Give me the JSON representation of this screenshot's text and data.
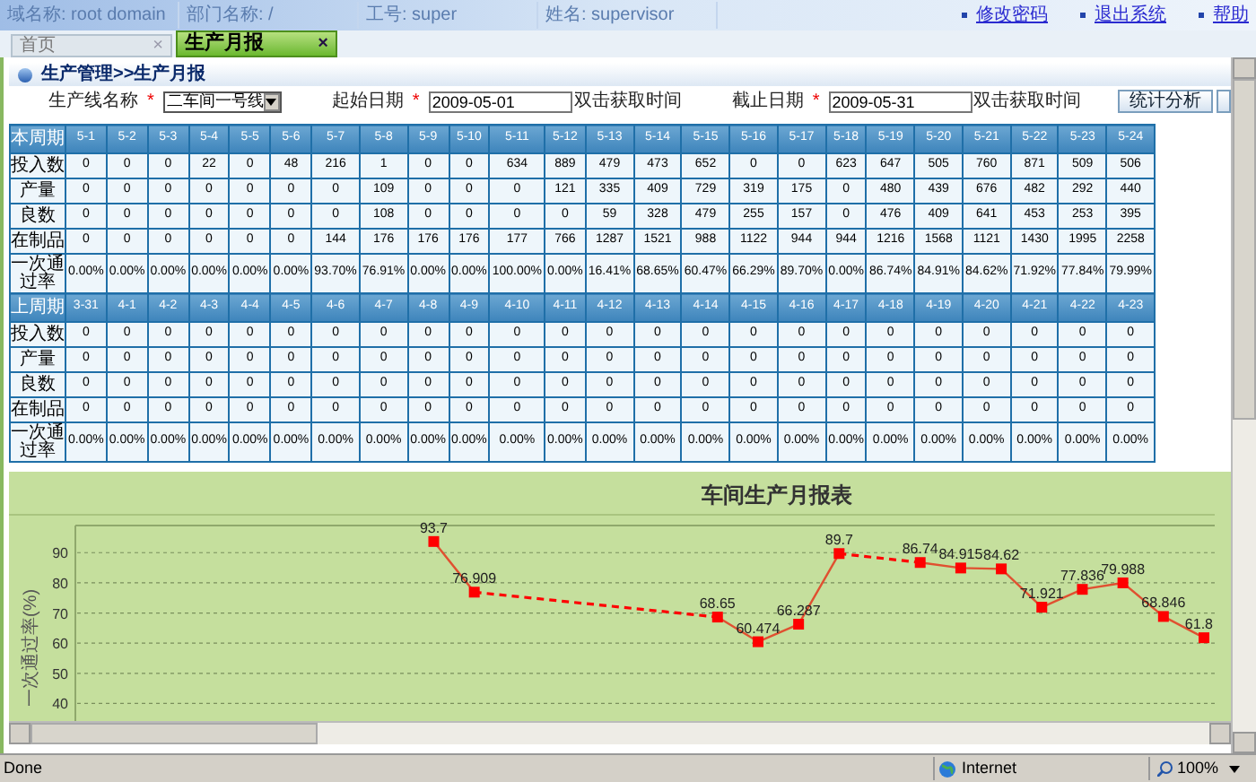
{
  "top_bar": {
    "fields": [
      "域名称: root domain",
      "部门名称: /",
      "工号: super",
      "姓名: supervisor"
    ],
    "links": [
      "修改密码",
      "退出系统",
      "帮助"
    ]
  },
  "tabs": [
    {
      "label": "首页",
      "close": "×",
      "selected": false
    },
    {
      "label": "生产月报",
      "close": "×",
      "selected": true
    }
  ],
  "breadcrumb": "生产管理>>生产月报",
  "form": {
    "fields": [
      {
        "kind": "select",
        "label": "生产线名称",
        "mark": "*",
        "value": "二车间一号线"
      },
      {
        "kind": "date",
        "label": "起始日期",
        "mark": "*",
        "value": "2009-05-01",
        "hint": "双击获取时间"
      },
      {
        "kind": "date",
        "label": "截止日期",
        "mark": "*",
        "value": "2009-05-31",
        "hint": "双击获取时间"
      }
    ],
    "button": "统计分析"
  },
  "tables": [
    {
      "period": "本周期",
      "dates": [
        "5-1",
        "5-2",
        "5-3",
        "5-4",
        "5-5",
        "5-6",
        "5-7",
        "5-8",
        "5-9",
        "5-10",
        "5-11",
        "5-12",
        "5-13",
        "5-14",
        "5-15",
        "5-16",
        "5-17",
        "5-18",
        "5-19",
        "5-20",
        "5-21",
        "5-22",
        "5-23",
        "5-24"
      ],
      "rows": [
        {
          "label": "投入数",
          "values": [
            "0",
            "0",
            "0",
            "22",
            "0",
            "48",
            "216",
            "1",
            "0",
            "0",
            "634",
            "889",
            "479",
            "473",
            "652",
            "0",
            "0",
            "623",
            "647",
            "505",
            "760",
            "871",
            "509",
            "506"
          ]
        },
        {
          "label": "产量",
          "values": [
            "0",
            "0",
            "0",
            "0",
            "0",
            "0",
            "0",
            "109",
            "0",
            "0",
            "0",
            "121",
            "335",
            "409",
            "729",
            "319",
            "175",
            "0",
            "480",
            "439",
            "676",
            "482",
            "292",
            "440"
          ]
        },
        {
          "label": "良数",
          "values": [
            "0",
            "0",
            "0",
            "0",
            "0",
            "0",
            "0",
            "108",
            "0",
            "0",
            "0",
            "0",
            "59",
            "328",
            "479",
            "255",
            "157",
            "0",
            "476",
            "409",
            "641",
            "453",
            "253",
            "395"
          ]
        },
        {
          "label": "在制品",
          "values": [
            "0",
            "0",
            "0",
            "0",
            "0",
            "0",
            "144",
            "176",
            "176",
            "176",
            "177",
            "766",
            "1287",
            "1521",
            "988",
            "1122",
            "944",
            "944",
            "1216",
            "1568",
            "1121",
            "1430",
            "1995",
            "2258"
          ]
        },
        {
          "label": "一次通过率",
          "values": [
            "0.00%",
            "0.00%",
            "0.00%",
            "0.00%",
            "0.00%",
            "0.00%",
            "93.70%",
            "76.91%",
            "0.00%",
            "0.00%",
            "100.00%",
            "0.00%",
            "16.41%",
            "68.65%",
            "60.47%",
            "66.29%",
            "89.70%",
            "0.00%",
            "86.74%",
            "84.91%",
            "84.62%",
            "71.92%",
            "77.84%",
            "79.99%"
          ]
        }
      ]
    },
    {
      "period": "上周期",
      "dates": [
        "3-31",
        "4-1",
        "4-2",
        "4-3",
        "4-4",
        "4-5",
        "4-6",
        "4-7",
        "4-8",
        "4-9",
        "4-10",
        "4-11",
        "4-12",
        "4-13",
        "4-14",
        "4-15",
        "4-16",
        "4-17",
        "4-18",
        "4-19",
        "4-20",
        "4-21",
        "4-22",
        "4-23"
      ],
      "rows": [
        {
          "label": "投入数",
          "values": [
            "0",
            "0",
            "0",
            "0",
            "0",
            "0",
            "0",
            "0",
            "0",
            "0",
            "0",
            "0",
            "0",
            "0",
            "0",
            "0",
            "0",
            "0",
            "0",
            "0",
            "0",
            "0",
            "0",
            "0"
          ]
        },
        {
          "label": "产量",
          "values": [
            "0",
            "0",
            "0",
            "0",
            "0",
            "0",
            "0",
            "0",
            "0",
            "0",
            "0",
            "0",
            "0",
            "0",
            "0",
            "0",
            "0",
            "0",
            "0",
            "0",
            "0",
            "0",
            "0",
            "0"
          ]
        },
        {
          "label": "良数",
          "values": [
            "0",
            "0",
            "0",
            "0",
            "0",
            "0",
            "0",
            "0",
            "0",
            "0",
            "0",
            "0",
            "0",
            "0",
            "0",
            "0",
            "0",
            "0",
            "0",
            "0",
            "0",
            "0",
            "0",
            "0"
          ]
        },
        {
          "label": "在制品",
          "values": [
            "0",
            "0",
            "0",
            "0",
            "0",
            "0",
            "0",
            "0",
            "0",
            "0",
            "0",
            "0",
            "0",
            "0",
            "0",
            "0",
            "0",
            "0",
            "0",
            "0",
            "0",
            "0",
            "0",
            "0"
          ]
        },
        {
          "label": "一次通过率",
          "values": [
            "0.00%",
            "0.00%",
            "0.00%",
            "0.00%",
            "0.00%",
            "0.00%",
            "0.00%",
            "0.00%",
            "0.00%",
            "0.00%",
            "0.00%",
            "0.00%",
            "0.00%",
            "0.00%",
            "0.00%",
            "0.00%",
            "0.00%",
            "0.00%",
            "0.00%",
            "0.00%",
            "0.00%",
            "0.00%",
            "0.00%",
            "0.00%"
          ]
        }
      ]
    }
  ],
  "chart": {
    "chart_data": {
      "type": "line",
      "title": "车间生产月报表",
      "ylabel": "一次通过率(%)",
      "series": [
        {
          "color": "#e05030",
          "marker": "square",
          "values": [
            null,
            null,
            null,
            null,
            null,
            null,
            null,
            null,
            93.7,
            76.909,
            null,
            null,
            null,
            null,
            null,
            68.65,
            60.474,
            66.287,
            89.7,
            null,
            86.74,
            84.915,
            84.62,
            71.921,
            77.836,
            79.988,
            68.846,
            61.8
          ]
        }
      ],
      "ylim": [
        33,
        99
      ],
      "yticks": [
        40,
        50,
        60,
        70,
        80,
        90
      ],
      "grid": true,
      "data_labels": true
    }
  },
  "status_bar": {
    "text": "Done",
    "zone": "Internet",
    "zoom": "100%"
  }
}
